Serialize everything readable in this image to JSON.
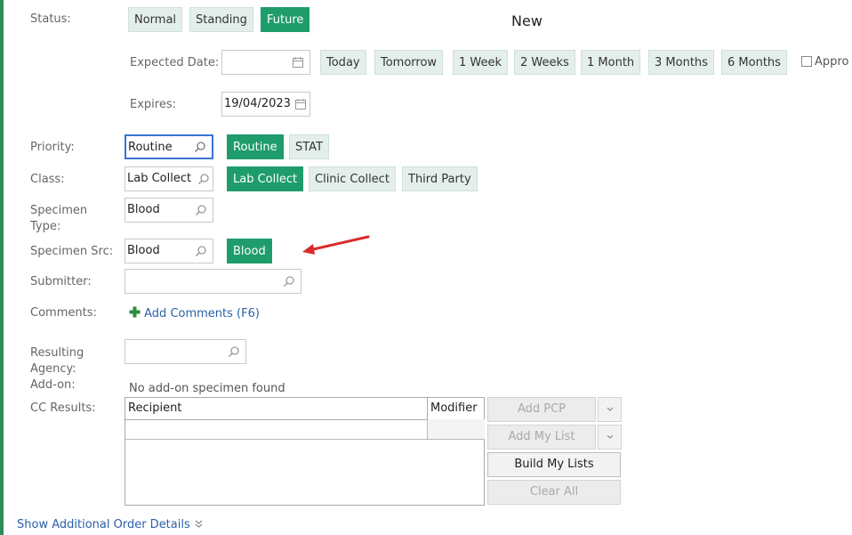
{
  "status": {
    "label": "Status:",
    "options": [
      "Normal",
      "Standing",
      "Future"
    ],
    "selected": "Future",
    "new_label": "New"
  },
  "expected_date": {
    "label": "Expected Date:",
    "value": "",
    "quick_buttons": [
      "Today",
      "Tomorrow",
      "1 Week",
      "2 Weeks",
      "1 Month",
      "3 Months",
      "6 Months"
    ],
    "approx_label": "Appro"
  },
  "expires": {
    "label": "Expires:",
    "value": "19/04/2023"
  },
  "priority": {
    "label": "Priority:",
    "value": "Routine",
    "options": [
      "Routine",
      "STAT"
    ],
    "selected": "Routine"
  },
  "class": {
    "label": "Class:",
    "value": "Lab Collect",
    "options": [
      "Lab Collect",
      "Clinic Collect",
      "Third Party"
    ],
    "selected": "Lab Collect"
  },
  "specimen_type": {
    "label_line1": "Specimen",
    "label_line2": "Type:",
    "value": "Blood"
  },
  "specimen_src": {
    "label": "Specimen Src:",
    "value": "Blood",
    "options": [
      "Blood"
    ],
    "selected": "Blood"
  },
  "submitter": {
    "label": "Submitter:",
    "value": ""
  },
  "comments": {
    "label": "Comments:",
    "add_link": "Add Comments (F6)"
  },
  "resulting_agency": {
    "label_line1": "Resulting",
    "label_line2": "Agency:",
    "value": ""
  },
  "add_on": {
    "label": "Add-on:",
    "text": "No add-on specimen found"
  },
  "cc_results": {
    "label": "CC Results:",
    "columns": [
      "Recipient",
      "Modifier"
    ],
    "buttons": {
      "add_pcp": "Add PCP",
      "add_my_list": "Add My List",
      "build_my_lists": "Build My Lists",
      "clear_all": "Clear All"
    }
  },
  "footer": {
    "show_more": "Show Additional Order Details"
  },
  "colors": {
    "accent_green": "#1f9c6b",
    "chip_bg": "#e4efec",
    "link_blue": "#2a61a8",
    "arrow_red": "#d92b2b"
  }
}
